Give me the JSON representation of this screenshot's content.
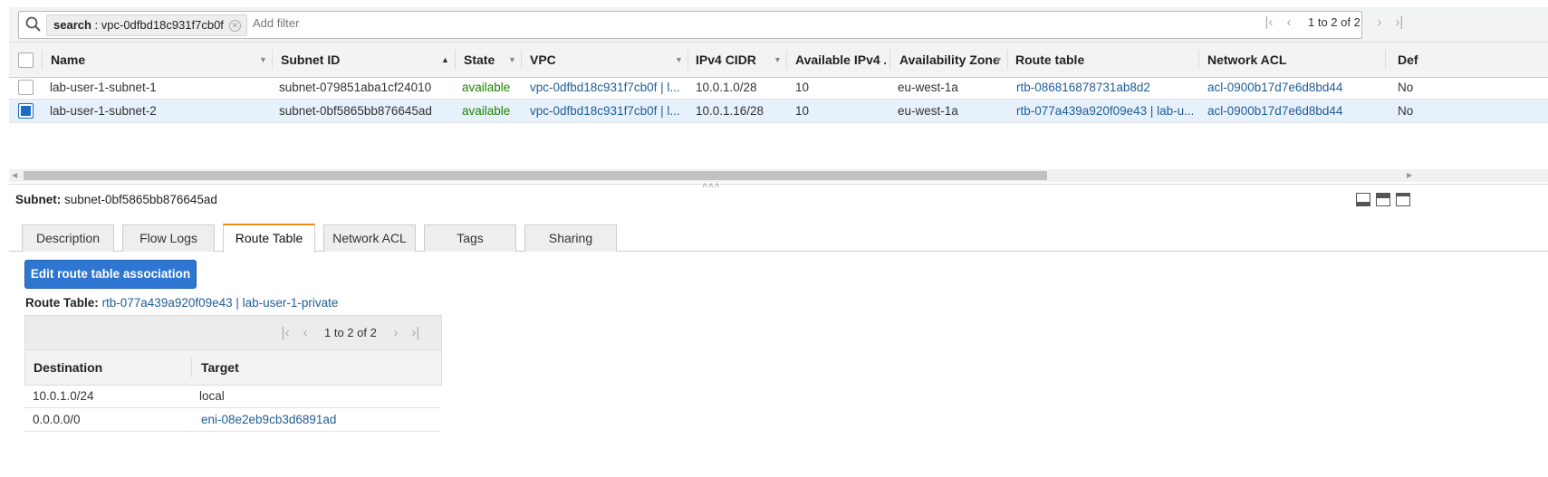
{
  "filter": {
    "token_key": "search",
    "token_value": "vpc-0dfbd18c931f7cb0f",
    "add_filter_placeholder": "Add filter",
    "pagination": "1 to 2 of 2"
  },
  "table": {
    "columns": [
      "Name",
      "Subnet ID",
      "State",
      "VPC",
      "IPv4 CIDR",
      "Available IPv4 ...",
      "Availability Zone",
      "Route table",
      "Network ACL",
      "Def"
    ],
    "rows": [
      {
        "name": "lab-user-1-subnet-1",
        "subnet_id": "subnet-079851aba1cf24010",
        "state": "available",
        "vpc": "vpc-0dfbd18c931f7cb0f | l...",
        "cidr": "10.0.1.0/28",
        "available_ipv4": "10",
        "az": "eu-west-1a",
        "route_table": "rtb-086816878731ab8d2",
        "network_acl": "acl-0900b17d7e6d8bd44",
        "default": "No",
        "selected": false
      },
      {
        "name": "lab-user-1-subnet-2",
        "subnet_id": "subnet-0bf5865bb876645ad",
        "state": "available",
        "vpc": "vpc-0dfbd18c931f7cb0f | l...",
        "cidr": "10.0.1.16/28",
        "available_ipv4": "10",
        "az": "eu-west-1a",
        "route_table": "rtb-077a439a920f09e43 | lab-u...",
        "network_acl": "acl-0900b17d7e6d8bd44",
        "default": "No",
        "selected": true
      }
    ]
  },
  "detail": {
    "subnet_label": "Subnet:",
    "subnet_id": "subnet-0bf5865bb876645ad",
    "tabs": [
      "Description",
      "Flow Logs",
      "Route Table",
      "Network ACL",
      "Tags",
      "Sharing"
    ],
    "active_tab": "Route Table",
    "edit_button": "Edit route table association",
    "route_table_label": "Route Table:",
    "route_table_value": "rtb-077a439a920f09e43 | lab-user-1-private",
    "routes_pagination": "1 to 2 of 2",
    "route_columns": [
      "Destination",
      "Target"
    ],
    "routes": [
      {
        "destination": "10.0.1.0/24",
        "target": "local",
        "target_is_link": false
      },
      {
        "destination": "0.0.0.0/0",
        "target": "eni-08e2eb9cb3d6891ad",
        "target_is_link": true
      }
    ]
  },
  "colors": {
    "link": "#1f5d97",
    "available": "#1d8102",
    "primary_button": "#2e76d1",
    "active_tab_accent": "#e88d14",
    "selected_row": "#e7f1fb"
  }
}
